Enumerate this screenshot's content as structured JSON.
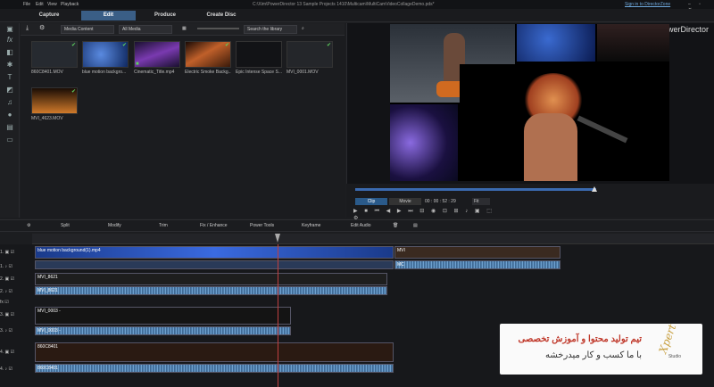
{
  "menu": {
    "file": "File",
    "edit": "Edit",
    "view": "View",
    "playback": "Playback"
  },
  "window_title": "C:\\Xim\\PowerDirector 13 Sample Projects 1410\\Multicam\\MultiCamVideoCollageDemo.pds*",
  "signin": "Sign in to DirectorZone",
  "app_name": "PowerDirector",
  "modes": {
    "capture": "Capture",
    "edit": "Edit",
    "produce": "Produce",
    "create_disc": "Create Disc"
  },
  "library": {
    "content_filter": "Media Content",
    "media_filter": "All Media",
    "search_placeholder": "Search the library",
    "items": [
      {
        "label": "860C8401.MOV",
        "color": "#2a2f35"
      },
      {
        "label": "blue motion backgro...",
        "color": "#1e3e7a"
      },
      {
        "label": "Cinematic_Title.mp4",
        "color": "#4a2a6a"
      },
      {
        "label": "Electric Smoke Backg...",
        "color": "#6a3a1a"
      },
      {
        "label": "Epic Intense Space S...",
        "color": "#15161a"
      },
      {
        "label": "MVI_0001.MOV",
        "color": "#25272b"
      },
      {
        "label": "MVI_4623.MOV",
        "color": "#7a4a20"
      }
    ]
  },
  "preview": {
    "clip_tab": "Clip",
    "movie_tab": "Movie",
    "timecode": "00 : 00 : 52 : 29",
    "fit": "Fit"
  },
  "edit_tabs": {
    "split": "Split",
    "modify": "Modify",
    "trim": "Trim",
    "fix_enhance": "Fix / Enhance",
    "power_tools": "Power Tools",
    "keyframe": "Keyframe",
    "edit_audio": "Edit Audio"
  },
  "tracks": {
    "t1": "1.",
    "t2": "2.",
    "t3": "3.",
    "t4": "4.",
    "fx": "fx"
  },
  "clips": {
    "c1": "blue motion background(1).mp4",
    "c2": "MVI_8621",
    "c3": "MVI_0003 -",
    "c4": "860C8401",
    "c5": "MVI_8621",
    "c6": "MVI_0003 -",
    "c7": "860C8401",
    "c8": "MVI",
    "c9": "MC"
  },
  "watermark": {
    "line1": "تیم تولید محتوا و آموزش تخصصی",
    "line2": "با ما کسب و کار میدرخشه",
    "brand": "Xpert",
    "brand2": "Studio"
  }
}
